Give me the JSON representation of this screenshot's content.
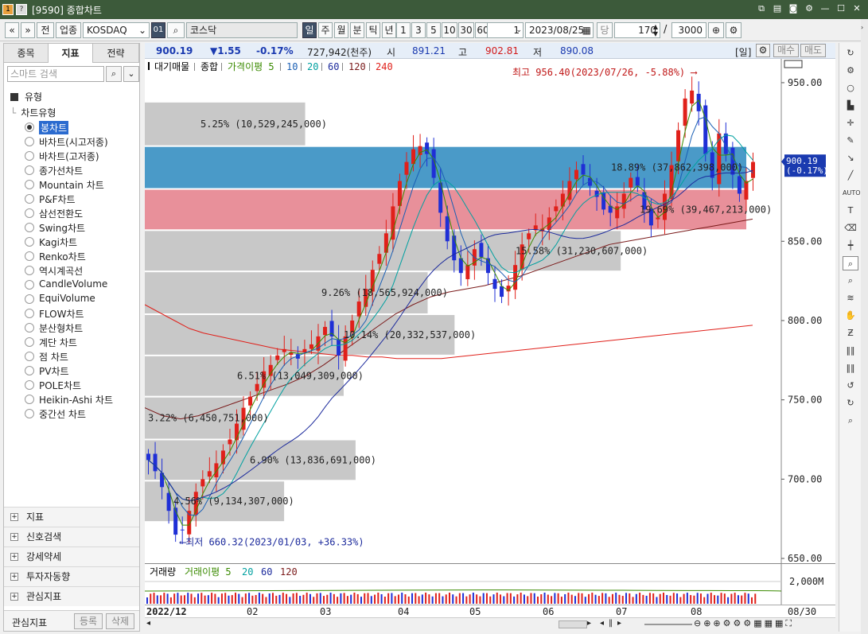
{
  "window": {
    "title": "[9590] 종합차트",
    "code_icon": "1",
    "help_icon": "?"
  },
  "toolbar": {
    "nav_left": "«",
    "nav_down": "»",
    "btn_prev": "전",
    "market_type": "업종",
    "market": "KOSDAQ",
    "index_name": "코스닥",
    "periods": [
      "일",
      "주",
      "월",
      "분",
      "틱",
      "년"
    ],
    "intervals": [
      "1",
      "3",
      "5",
      "10",
      "30",
      "60"
    ],
    "interval_value": "1",
    "date": "2023/08/25",
    "day_label": "당",
    "count": "170",
    "slash": "/",
    "total": "3000"
  },
  "info": {
    "price": "900.19",
    "change": "▼1.55",
    "pct": "-0.17%",
    "volume": "727,942(천주)",
    "open_label": "시",
    "open": "891.21",
    "high_label": "고",
    "high": "902.81",
    "low_label": "저",
    "low": "890.08",
    "period": "[일]",
    "buy": "매수",
    "sell": "매도"
  },
  "left": {
    "tabs": [
      "종목",
      "지표",
      "전략"
    ],
    "active_tab": 1,
    "search_placeholder": "스마트 검색",
    "section": "유형",
    "subsection": "차트유형",
    "chart_types": [
      "봉차트",
      "바차트(시고저종)",
      "바차트(고저종)",
      "종가선차트",
      "Mountain 차트",
      "P&F차트",
      "삼선전환도",
      "Swing차트",
      "Kagi차트",
      "Renko차트",
      "역시계곡선",
      "CandleVolume",
      "EquiVolume",
      "FLOW차트",
      "분산형차트",
      "계단 차트",
      "점 차트",
      "PV차트",
      "POLE차트",
      "Heikin-Ashi 차트",
      "중간선 차트"
    ],
    "selected_type": 0,
    "bottom_sections": [
      "지표",
      "신호검색",
      "강세약세",
      "투자자동향",
      "관심지표"
    ],
    "fav_label": "관심지표",
    "register": "등록",
    "delete": "삭제"
  },
  "legend": {
    "items": [
      {
        "label": "대기매물",
        "color": "#000000"
      },
      {
        "label": "종합",
        "color": "#000000"
      },
      {
        "label": "가격이평 5",
        "color": "#3a8a00"
      },
      {
        "label": "10",
        "color": "#1a5fb4"
      },
      {
        "label": "20",
        "color": "#00a0a0"
      },
      {
        "label": "60",
        "color": "#1c2a9c"
      },
      {
        "label": "120",
        "color": "#7a1a1a"
      },
      {
        "label": "240",
        "color": "#e0201a"
      }
    ]
  },
  "vol_legend": {
    "items": [
      {
        "label": "거래량",
        "color": "#000000"
      },
      {
        "label": "거래이평 5",
        "color": "#3a8a00"
      },
      {
        "label": "20",
        "color": "#00a0a0"
      },
      {
        "label": "60",
        "color": "#1c2a9c"
      },
      {
        "label": "120",
        "color": "#7a1a1a"
      }
    ],
    "y_label": "2,000M"
  },
  "annotations": {
    "high": "최고 956.40(2023/07/26, -5.88%)",
    "low": "최저 660.32(2023/01/03, +36.33%)",
    "price_tag": "900.19",
    "price_tag_pct": "(-0.17%)"
  },
  "x_labels": [
    "2022/12",
    "02",
    "03",
    "04",
    "05",
    "06",
    "07",
    "08",
    "08/30"
  ],
  "colors": {
    "up": "#e0201a",
    "down": "#1f2fd6",
    "vp_up": "#4a9ac8",
    "vp_down": "#e8909a",
    "vp_gray": "#c8c8c8"
  },
  "chart_data": {
    "type": "candlestick",
    "ylim": [
      650,
      960
    ],
    "y_ticks": [
      650,
      700,
      750,
      800,
      850,
      900,
      950
    ],
    "y_tick_labels": [
      "650.00",
      "700.00",
      "750.00",
      "800.00",
      "850.00",
      "900.00",
      "950.00"
    ],
    "volume_profile": [
      {
        "label": "5.25% (10,529,245,000)",
        "lo": 910,
        "hi": 938,
        "pct": 5.25,
        "kind": "gray"
      },
      {
        "label": "18.89% (37,862,398,000)",
        "lo": 883,
        "hi": 910,
        "pct": 18.89,
        "kind": "up"
      },
      {
        "label": "19.69% (39,467,213,000)",
        "lo": 857,
        "hi": 883,
        "pct": 19.69,
        "kind": "down"
      },
      {
        "label": "15.58% (31,230,607,000)",
        "lo": 831,
        "hi": 857,
        "pct": 15.58,
        "kind": "gray"
      },
      {
        "label": "9.26% (18,565,924,000)",
        "lo": 804,
        "hi": 831,
        "pct": 9.26,
        "kind": "gray"
      },
      {
        "label": "10.14% (20,332,537,000)",
        "lo": 778,
        "hi": 804,
        "pct": 10.14,
        "kind": "gray"
      },
      {
        "label": "6.51% (13,049,309,000)",
        "lo": 752,
        "hi": 778,
        "pct": 6.51,
        "kind": "gray"
      },
      {
        "label": "3.22% (6,450,751,000)",
        "lo": 725,
        "hi": 752,
        "pct": 3.22,
        "kind": "gray"
      },
      {
        "label": "6.90% (13,836,691,000)",
        "lo": 699,
        "hi": 725,
        "pct": 6.9,
        "kind": "gray"
      },
      {
        "label": "4.56% (9,134,307,000)",
        "lo": 673,
        "hi": 699,
        "pct": 4.56,
        "kind": "gray"
      }
    ],
    "close_path": [
      712,
      705,
      695,
      680,
      665,
      668,
      680,
      692,
      700,
      705,
      710,
      718,
      725,
      735,
      745,
      752,
      760,
      768,
      772,
      778,
      782,
      780,
      776,
      782,
      785,
      790,
      796,
      790,
      778,
      790,
      800,
      812,
      820,
      832,
      842,
      855,
      872,
      888,
      900,
      908,
      910,
      905,
      890,
      868,
      850,
      838,
      830,
      835,
      845,
      840,
      830,
      820,
      815,
      822,
      835,
      848,
      855,
      860,
      858,
      865,
      872,
      880,
      888,
      895,
      892,
      885,
      878,
      870,
      868,
      872,
      880,
      890,
      885,
      870,
      860,
      865,
      880,
      898,
      920,
      940,
      945,
      932,
      905,
      890,
      918,
      905,
      892,
      880,
      888,
      900
    ],
    "ma240_path": [
      810,
      805,
      800,
      795,
      792,
      790,
      788,
      786,
      784,
      782,
      781,
      780,
      779,
      778,
      778,
      777,
      777,
      776,
      776,
      776,
      776,
      777,
      778,
      779,
      780,
      781,
      782,
      783,
      784,
      785,
      786,
      787,
      788,
      789,
      790,
      791,
      792,
      793,
      794,
      795,
      796,
      797
    ],
    "ma120_path": [
      745,
      740,
      738,
      740,
      744,
      748,
      752,
      756,
      760,
      765,
      772,
      780,
      788,
      796,
      804,
      810,
      815,
      818,
      820,
      822,
      825,
      828,
      832,
      836,
      840,
      844,
      848,
      850,
      852,
      854,
      856,
      858,
      860,
      862,
      864
    ]
  }
}
